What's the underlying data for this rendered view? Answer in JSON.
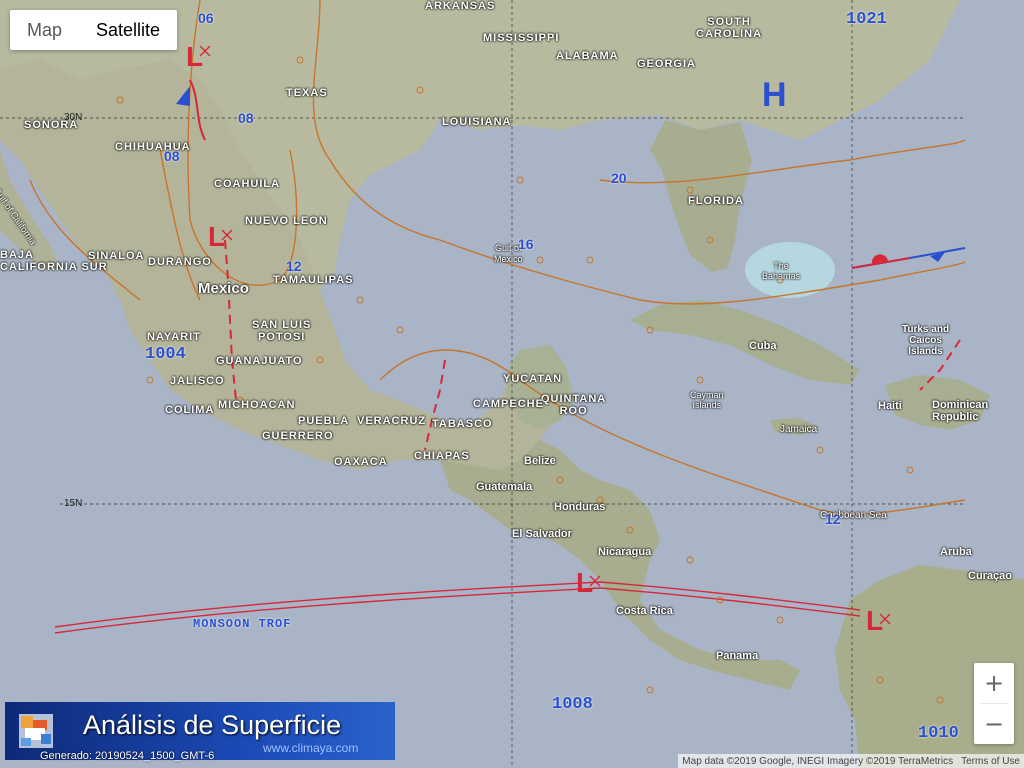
{
  "map_type_control": {
    "map_label": "Map",
    "satellite_label": "Satellite",
    "selected": "Satellite"
  },
  "banner": {
    "title": "Análisis de Superficie",
    "website": "www.climaya.com",
    "generated": "Generado: 20190524_1500_GMT-6"
  },
  "attribution": {
    "map_data": "Map data ©2019 Google, INEGI Imagery ©2019 TerraMetrics",
    "terms": "Terms of Use"
  },
  "zoom": {
    "in": "+",
    "out": "−"
  },
  "pressure_centers": [
    {
      "symbol": "H",
      "color": "#2a4fd1"
    },
    {
      "symbol": "L",
      "color": "#e03a3a"
    }
  ],
  "isobars_labels": [
    "1021",
    "1004",
    "1008",
    "1010",
    "06",
    "08",
    "08",
    "12",
    "16",
    "20",
    "12"
  ],
  "front_label": "MONSOON TROF",
  "latitude_labels": [
    "30N",
    "15N"
  ],
  "place_labels": {
    "arkansas": "ARKANSAS",
    "mississippi": "MISSISSIPPI",
    "south_carolina": "SOUTH\nCAROLINA",
    "alabama": "ALABAMA",
    "georgia": "GEORGIA",
    "texas": "TEXAS",
    "louisiana": "LOUISIANA",
    "sonora": "SONORA",
    "chihuahua": "CHIHUAHUA",
    "coahuila": "COAHUILA",
    "nuevo_leon": "NUEVO LEON",
    "florida": "FLORIDA",
    "gulf_of_california": "Gulf of California",
    "baja_california_sur": "BAJA\nCALIFORNIA SUR",
    "sinaloa": "SINALOA",
    "durango": "DURANGO",
    "tamaulipas": "TAMAULIPAS",
    "gulf_of_mexico": "Gulf of\nMexico",
    "the_bahamas": "The\nBahamas",
    "mexico": "Mexico",
    "nayarit": "NAYARIT",
    "san_luis_potosi": "SAN LUIS\nPOTOSI",
    "guanajuato": "GUANAJUATO",
    "turks_caicos": "Turks and\nCaicos\nIslands",
    "jalisco": "JALISCO",
    "yucatan": "YUCATAN",
    "cuba": "Cuba",
    "quintana_roo": "QUINTANA\nROO",
    "campeche": "CAMPECHE",
    "colima": "COLIMA",
    "michoacan": "MICHOACAN",
    "cayman": "Cayman\nIslands",
    "haiti": "Haiti",
    "dominican": "Dominican\nRepublic",
    "puebla": "PUEBLA",
    "veracruz": "VERACRUZ",
    "tabasco": "TABASCO",
    "guerrero": "GUERRERO",
    "jamaica": "Jamaica",
    "oaxaca": "OAXACA",
    "chiapas": "CHIAPAS",
    "belize": "Belize",
    "guatemala": "Guatemala",
    "honduras": "Honduras",
    "caribbean_sea": "Caribbean Sea",
    "el_salvador": "El Salvador",
    "aruba": "Aruba",
    "nicaragua": "Nicaragua",
    "curacao": "Curaçao",
    "costa_rica": "Costa Rica",
    "panama": "Panama"
  },
  "colors": {
    "isobar": "#c8742a",
    "front_red": "#d6283a",
    "front_blue": "#2a4fd1",
    "label_blue": "#2a4fd1"
  }
}
